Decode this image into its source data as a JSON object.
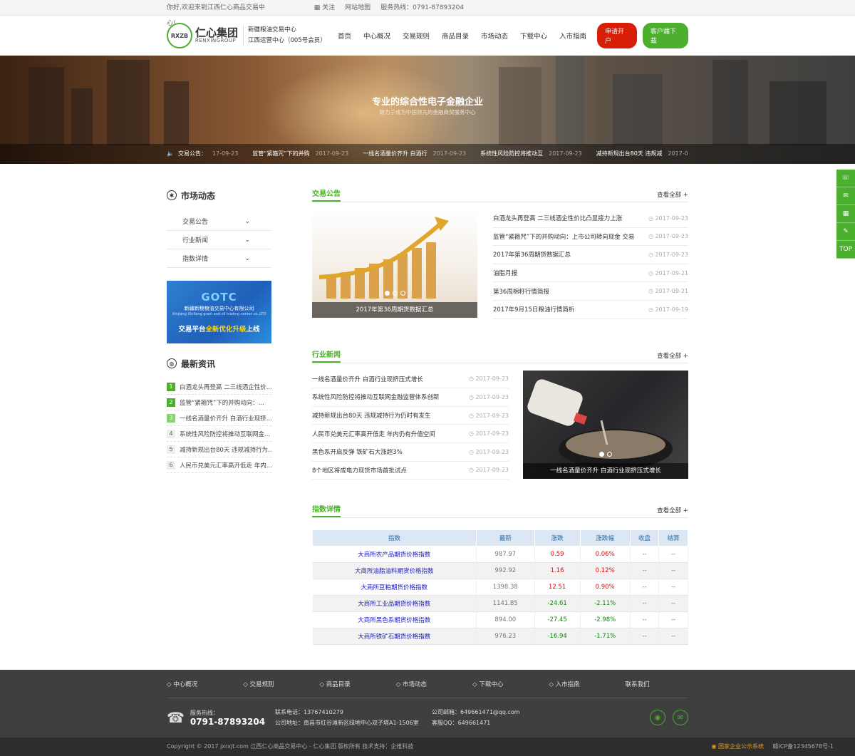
{
  "topbar": {
    "welcome": "你好,欢迎来到江西仁心商品交易中心!",
    "follow": "关注",
    "sitemap": "网站地图",
    "hotline": "服务热线：0791-87893204"
  },
  "logo": {
    "mark": "RXZB",
    "cn": "仁心集团",
    "en": "RENXINGROUP",
    "sub1": "新疆粮油交易中心",
    "sub2": "江西运营中心（005号会员）"
  },
  "nav": [
    "首页",
    "中心概况",
    "交易规则",
    "商品目录",
    "市场动态",
    "下载中心",
    "入市指南"
  ],
  "nav_btn": {
    "apply": "申请开户",
    "download": "客户端下载"
  },
  "banner": {
    "title": "专业的综合性电子金融企业",
    "subtitle": "致力于成为中国领先的金融商贸服务中心"
  },
  "notice": {
    "label": "交易公告：",
    "items": [
      {
        "t": "",
        "d": "17-09-23"
      },
      {
        "t": "监管“紧箍咒”下的并购",
        "d": "2017-09-23"
      },
      {
        "t": "一线名酒量价齐升 白酒行",
        "d": "2017-09-23"
      },
      {
        "t": "系统性风险防控将推动互",
        "d": "2017-09-23"
      },
      {
        "t": "减持新规出台80天 违规减",
        "d": "2017-09-23"
      }
    ]
  },
  "float": {
    "top": "TOP"
  },
  "left": {
    "market_title": "市场动态",
    "cats": [
      "交易公告",
      "行业新闻",
      "指数详情"
    ],
    "ad": {
      "brand": "GOTC",
      "company": "新疆新粮粮油交易中心有限公司",
      "company_en": "Xinjiang Xinliang grain and oil trading center co.,LTD",
      "line_a": "交易平台",
      "line_b": "全新优化升级",
      "line_c": "上线"
    },
    "news_title": "最新资讯",
    "news": [
      {
        "n": "1",
        "t": "白酒龙头再登高 二三线酒企性价..."
      },
      {
        "n": "2",
        "t": "监管“紧箍咒”下的并购动向：..."
      },
      {
        "n": "3",
        "t": "一线名酒量价齐升 白酒行业现挤..."
      },
      {
        "n": "4",
        "t": "系统性风险防控将推动互联网金..."
      },
      {
        "n": "5",
        "t": "减持新规出台80天 违规减持行为..."
      },
      {
        "n": "6",
        "t": "人民币兑美元汇率高开低走 年内..."
      }
    ]
  },
  "b1": {
    "title": "交易公告",
    "more": "查看全部 +",
    "caption": "2017年第36周期货数据汇总",
    "items": [
      {
        "t": "白酒龙头再登高 二三线酒企性价比凸显接力上涨",
        "d": "2017-09-23"
      },
      {
        "t": "监管“紧箍咒”下的并购动向：上市公司转向现金 交易",
        "d": "2017-09-23"
      },
      {
        "t": "2017年第36周期货数据汇总",
        "d": "2017-09-23"
      },
      {
        "t": "油脂月报",
        "d": "2017-09-21"
      },
      {
        "t": "第36周棉籽行情简报",
        "d": "2017-09-21"
      },
      {
        "t": "2017年9月15日粮油行情简析",
        "d": "2017-09-19"
      }
    ]
  },
  "b2": {
    "title": "行业新闻",
    "more": "查看全部 +",
    "caption": "一线名酒量价齐升 白酒行业现挤压式增长",
    "items": [
      {
        "t": "一线名酒量价齐升 白酒行业现挤压式增长",
        "d": "2017-09-23"
      },
      {
        "t": "系统性风险防控将推动互联网金融监管体系创新",
        "d": "2017-09-23"
      },
      {
        "t": "减持新规出台80天 违规减持行为仍时有发生",
        "d": "2017-09-23"
      },
      {
        "t": "人民币兑美元汇率高开低走 年内仍有升值空间",
        "d": "2017-09-23"
      },
      {
        "t": "黑色系开启反弹 铁矿石大涨超3%",
        "d": "2017-09-23"
      },
      {
        "t": "8个地区将成电力现货市场首批试点",
        "d": "2017-09-23"
      }
    ]
  },
  "b3": {
    "title": "指数详情",
    "more": "查看全部 +",
    "headers": [
      "指数",
      "最新",
      "涨跌",
      "涨跌幅",
      "收盘",
      "结算"
    ],
    "rows": [
      [
        "大商所农产品期货价格指数",
        "987.97",
        "0.59",
        "0.06%",
        "--",
        "--"
      ],
      [
        "大商所油脂油料期货价格指数",
        "992.92",
        "1.16",
        "0.12%",
        "--",
        "--"
      ],
      [
        "大商所豆粕期货价格指数",
        "1398.38",
        "12.51",
        "0.90%",
        "--",
        "--"
      ],
      [
        "大商所工业品期货价格指数",
        "1141.85",
        "-24.61",
        "-2.11%",
        "--",
        "--"
      ],
      [
        "大商所黑色系期货价格指数",
        "894.00",
        "-27.45",
        "-2.98%",
        "--",
        "--"
      ],
      [
        "大商所铁矿石期货价格指数",
        "976.23",
        "-16.94",
        "-1.71%",
        "--",
        "--"
      ]
    ]
  },
  "footer": {
    "nav": [
      "中心概况",
      "交易规则",
      "商品目录",
      "市场动态",
      "下载中心",
      "入市指南",
      "联系我们"
    ],
    "tel_label": "服务热线：",
    "tel": "0791-87893204",
    "contact": "联系电话：13767410279",
    "address": "公司地址：南昌市红谷滩新区绿地中心双子塔A1-1506室",
    "email": "公司邮箱：649661471@qq.com",
    "qq": "客服QQ：649661471",
    "copyright": "Copyright © 2017 jxrxjt.com 江西仁心商品交易中心 - 仁心集团 版权所有   技术支持：企维科技",
    "gov": "国家企业公示系统",
    "icp": "赣ICP备12345678号-1"
  }
}
